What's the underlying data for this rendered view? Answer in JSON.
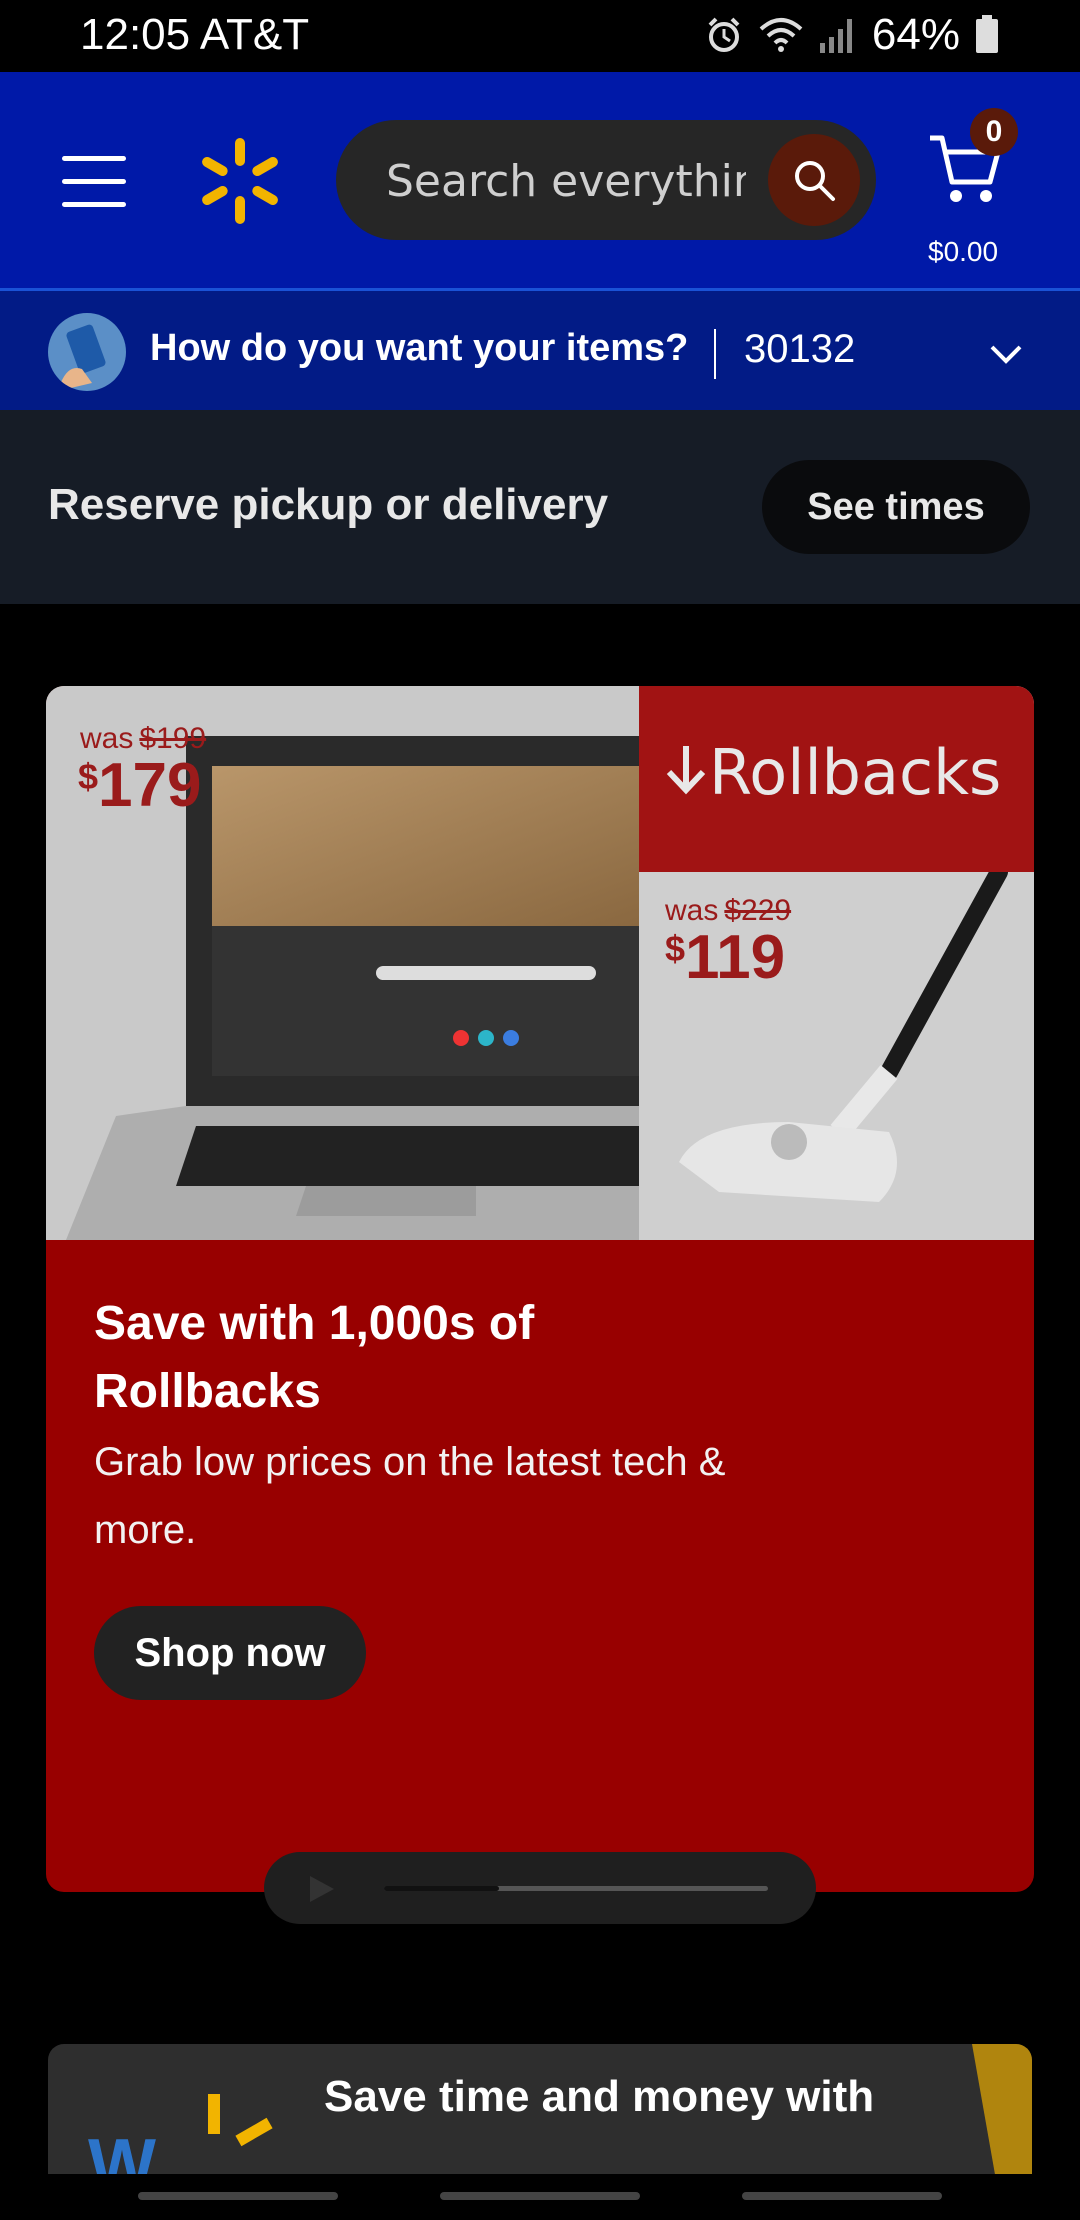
{
  "status": {
    "time": "12:05",
    "carrier": "AT&T",
    "battery": "64%"
  },
  "header": {
    "menu_icon": "hamburger-icon",
    "logo_icon": "walmart-spark-icon",
    "search": {
      "placeholder": "Search everything",
      "value": ""
    },
    "search_icon": "search-icon",
    "cart": {
      "count": "0",
      "total": "$0.00",
      "icon": "cart-icon"
    }
  },
  "fulfillment": {
    "question": "How do you want your items?",
    "zip": "30132",
    "chevron_icon": "chevron-down-icon"
  },
  "reserve": {
    "text": "Reserve pickup or delivery",
    "button": "See times"
  },
  "promo": {
    "laptop_was_label": "was",
    "laptop_was_price": "$199",
    "laptop_price_sup": "$",
    "laptop_price": "179",
    "banner_label": "Rollbacks",
    "vacuum_was_label": "was",
    "vacuum_was_price": "$229",
    "vacuum_price_sup": "$",
    "vacuum_price": "119",
    "title": "Save with 1,000s of Rollbacks",
    "subtitle": "Grab low prices on the latest tech & more.",
    "cta": "Shop now"
  },
  "carousel": {
    "progress": 0.3,
    "play_icon": "play-icon"
  },
  "bottom_card": {
    "text": "Save time and money with",
    "logo_text": "W"
  },
  "colors": {
    "header_bg": "#0019a8",
    "promo_bg": "#980000",
    "spark": "#f2b400"
  }
}
